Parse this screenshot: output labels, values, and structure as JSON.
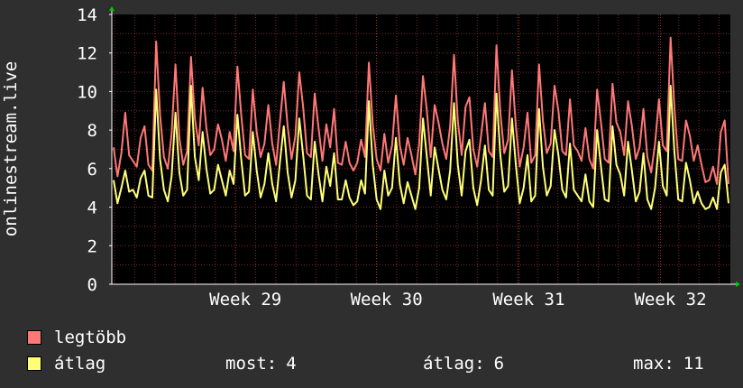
{
  "chart_data": {
    "type": "line",
    "ylabel": "onlinestream.live",
    "ylim": [
      0,
      14
    ],
    "y_ticks": [
      "0",
      "2",
      "4",
      "6",
      "8",
      "10",
      "12",
      "14"
    ],
    "x_tick_labels": [
      "Week 29",
      "Week 30",
      "Week 31",
      "Week 32"
    ],
    "grid": true,
    "colors": {
      "background": "#2f2f2f",
      "plot_bg": "#000000",
      "grid": "#7a2a2a",
      "axis": "#ffffff",
      "arrow": "#00cc00"
    },
    "series": [
      {
        "name": "legtöbb",
        "color": "#ff7777",
        "values": [
          7.1,
          5.6,
          6.8,
          8.9,
          6.7,
          6.4,
          6.1,
          7.6,
          8.2,
          6.2,
          5.9,
          12.6,
          8.8,
          6.6,
          6.0,
          7.8,
          11.4,
          7.6,
          6.2,
          6.9,
          11.8,
          8.6,
          7.2,
          10.2,
          8.1,
          6.7,
          7.0,
          8.3,
          7.5,
          6.4,
          7.9,
          6.9,
          11.3,
          8.8,
          6.7,
          6.5,
          10.1,
          7.9,
          6.6,
          7.3,
          9.3,
          7.3,
          6.2,
          8.4,
          10.5,
          8.2,
          6.5,
          7.7,
          11.0,
          9.2,
          6.8,
          6.6,
          9.9,
          8.1,
          6.4,
          8.3,
          7.1,
          9.1,
          6.3,
          6.2,
          7.4,
          6.3,
          5.9,
          6.3,
          7.5,
          6.6,
          11.5,
          8.3,
          6.5,
          5.9,
          7.8,
          6.3,
          7.2,
          9.8,
          7.2,
          6.2,
          7.6,
          6.7,
          5.7,
          7.3,
          10.8,
          9.0,
          6.6,
          9.3,
          8.4,
          7.3,
          6.5,
          8.2,
          11.9,
          8.5,
          6.7,
          9.2,
          9.7,
          7.0,
          6.1,
          7.7,
          9.4,
          6.9,
          6.6,
          12.4,
          8.9,
          6.8,
          7.5,
          11.1,
          8.2,
          6.1,
          7.1,
          8.9,
          6.3,
          6.7,
          11.4,
          8.5,
          6.8,
          7.3,
          10.3,
          9.0,
          6.9,
          6.7,
          9.6,
          7.2,
          6.9,
          6.4,
          8.1,
          6.5,
          6.0,
          10.1,
          8.4,
          6.5,
          6.3,
          10.4,
          8.4,
          7.9,
          6.7,
          9.5,
          8.2,
          6.5,
          7.1,
          9.1,
          6.6,
          5.8,
          7.3,
          9.6,
          7.2,
          6.9,
          12.8,
          9.2,
          6.5,
          6.4,
          8.5,
          7.7,
          6.4,
          7.2,
          6.2,
          5.3,
          5.4,
          6.1,
          5.2,
          7.9,
          8.5,
          5.2
        ]
      },
      {
        "name": "átlag",
        "color": "#ffff77",
        "values": [
          5.4,
          4.2,
          5.0,
          5.9,
          4.8,
          4.9,
          4.5,
          5.5,
          5.9,
          4.6,
          4.5,
          10.1,
          6.5,
          4.9,
          4.3,
          5.6,
          8.9,
          5.8,
          4.6,
          4.9,
          10.3,
          6.6,
          5.4,
          7.9,
          6.0,
          4.7,
          4.9,
          6.2,
          5.4,
          4.6,
          5.9,
          5.2,
          8.8,
          6.5,
          4.6,
          4.8,
          7.9,
          5.9,
          4.5,
          5.2,
          6.8,
          5.2,
          4.3,
          6.3,
          8.2,
          5.8,
          4.5,
          5.4,
          8.6,
          6.7,
          4.6,
          4.4,
          7.4,
          5.7,
          4.3,
          6.1,
          5.1,
          6.8,
          4.4,
          4.4,
          5.4,
          4.5,
          4.1,
          4.3,
          5.4,
          4.7,
          9.5,
          6.2,
          4.4,
          3.9,
          5.9,
          4.6,
          5.0,
          7.6,
          5.2,
          4.2,
          5.3,
          4.6,
          3.9,
          5.0,
          8.6,
          6.6,
          4.6,
          7.1,
          6.0,
          4.9,
          4.4,
          5.9,
          9.4,
          6.2,
          4.6,
          6.9,
          7.5,
          5.0,
          4.1,
          5.4,
          7.2,
          4.9,
          4.6,
          9.9,
          6.7,
          4.8,
          5.1,
          8.6,
          6.2,
          4.2,
          5.0,
          6.7,
          4.3,
          4.6,
          9.1,
          6.1,
          4.6,
          5.1,
          8.0,
          6.7,
          4.9,
          4.5,
          7.3,
          4.9,
          4.6,
          4.3,
          5.7,
          4.3,
          4.0,
          8.0,
          6.1,
          4.4,
          4.3,
          8.2,
          6.2,
          5.7,
          4.6,
          7.4,
          5.9,
          4.3,
          4.8,
          6.8,
          4.4,
          3.9,
          5.0,
          7.4,
          5.1,
          4.6,
          10.3,
          6.9,
          4.4,
          4.3,
          6.3,
          5.4,
          4.2,
          4.8,
          4.2,
          3.9,
          4.0,
          4.5,
          3.9,
          5.8,
          6.2,
          4.2
        ]
      }
    ]
  },
  "legend": [
    {
      "label": "legtöbb",
      "color": "#ff7777"
    },
    {
      "label": "átlag",
      "color": "#ffff77"
    }
  ],
  "stats": {
    "current_label": "most:",
    "current_value": "4",
    "average_label": "átlag:",
    "average_value": "6",
    "max_label": "max:",
    "max_value": "11"
  }
}
